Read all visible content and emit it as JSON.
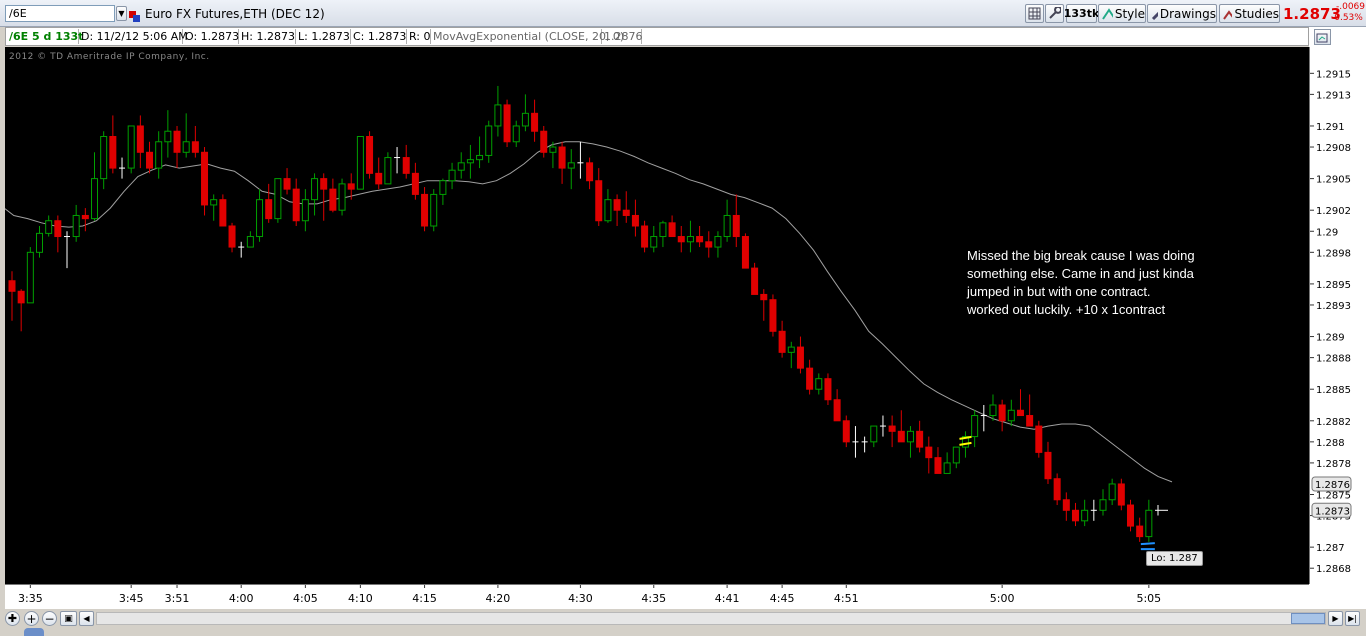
{
  "toolbar": {
    "symbol": "/6E",
    "title": "Euro FX Futures,ETH (DEC 12)",
    "tick_label": "133tk",
    "style_label": "Style",
    "drawings_label": "Drawings",
    "studies_label": "Studies",
    "last_price": "1.2873",
    "change": "-.0069",
    "change_pct": "-0.53%"
  },
  "infobar": {
    "symbol_period": "/6E 5 d 133t",
    "date": "D: 11/2/12 5:06 AM",
    "open": "O: 1.2873",
    "high": "H: 1.2873",
    "low": "L: 1.2873",
    "close": "C: 1.2873",
    "range": "R: 0",
    "study": "MovAvgExponential (CLOSE, 20, 0)",
    "study_value": "1.2876"
  },
  "watermark": "2012 © TD Ameritrade IP Company, Inc.",
  "annotation": [
    "Missed the big break cause I was doing",
    "something else.   Came in and just kinda",
    "jumped in but with one contract.",
    "worked out luckily.  +10 x 1contract"
  ],
  "low_label": "Lo: 1.287",
  "colors": {
    "up": "#00a000",
    "down": "#e00000",
    "neutral": "#ffffff",
    "ema": "#a0a0a0",
    "marker_yellow": "#ffff00",
    "marker_blue": "#1e90ff",
    "last_price": "#e00000"
  },
  "chart_data": {
    "type": "candlestick",
    "ylim": [
      1.28665,
      1.29175
    ],
    "y_ticks": [
      "1.2915",
      "1.2913",
      "1.291",
      "1.2908",
      "1.2905",
      "1.2902",
      "1.29",
      "1.2898",
      "1.2895",
      "1.2893",
      "1.289",
      "1.2888",
      "1.2885",
      "1.2882",
      "1.288",
      "1.2878",
      "1.2875",
      "1.2873",
      "1.287",
      "1.2868"
    ],
    "x_ticks": [
      "3:35",
      "3:45",
      "3:51",
      "4:00",
      "4:05",
      "4:10",
      "4:15",
      "4:20",
      "4:30",
      "4:35",
      "4:41",
      "4:45",
      "4:51",
      "5:00",
      "5:05"
    ],
    "price_labels": [
      "1.2876",
      "1.2873"
    ],
    "series": [
      {
        "name": "MovAvgExponential (CLOSE, 20, 0)",
        "values": [
          1.29025,
          1.29015,
          1.29012,
          1.29008,
          1.29005,
          1.29004,
          1.29005,
          1.2901,
          1.29022,
          1.29038,
          1.29052,
          1.29058,
          1.29063,
          1.2906,
          1.29062,
          1.29064,
          1.2906,
          1.29057,
          1.29048,
          1.29038,
          1.29035,
          1.29028,
          1.29026,
          1.29026,
          1.2903,
          1.29032,
          1.29035,
          1.29038,
          1.2904,
          1.29042,
          1.29045,
          1.29048,
          1.29048,
          1.29048,
          1.29047,
          1.29045,
          1.29048,
          1.29055,
          1.29064,
          1.29075,
          1.29082,
          1.29085,
          1.29085,
          1.29083,
          1.2908,
          1.29076,
          1.29071,
          1.29065,
          1.2906,
          1.29055,
          1.29049,
          1.29045,
          1.2904,
          1.29035,
          1.29032,
          1.29027,
          1.29022,
          1.29012,
          1.28998,
          1.28982,
          1.28962,
          1.28943,
          1.28925,
          1.28905,
          1.28893,
          1.2888,
          1.28867,
          1.28855,
          1.28847,
          1.2884,
          1.28834,
          1.28828,
          1.28822,
          1.28818,
          1.28814,
          1.28812,
          1.28815,
          1.28817,
          1.28817,
          1.28815,
          1.28805,
          1.28795,
          1.28785,
          1.28775,
          1.28767,
          1.28762
        ]
      }
    ],
    "candles": [
      [
        1.28953,
        1.28962,
        1.28915,
        1.28943
      ],
      [
        1.28943,
        1.28945,
        1.28905,
        1.28932
      ],
      [
        1.28932,
        1.28985,
        1.28932,
        1.2898
      ],
      [
        1.2898,
        1.29005,
        1.28975,
        1.28998
      ],
      [
        1.28998,
        1.29015,
        1.28995,
        1.2901
      ],
      [
        1.2901,
        1.29015,
        1.2898,
        1.28995
      ],
      [
        1.28995,
        1.29,
        1.28965,
        1.28995
      ],
      [
        1.28995,
        1.29025,
        1.2899,
        1.29015
      ],
      [
        1.29015,
        1.29022,
        1.29,
        1.29012
      ],
      [
        1.29012,
        1.29075,
        1.2901,
        1.2905
      ],
      [
        1.2905,
        1.29095,
        1.2904,
        1.2909
      ],
      [
        1.2909,
        1.2911,
        1.29055,
        1.2906
      ],
      [
        1.2906,
        1.2907,
        1.2905,
        1.2906
      ],
      [
        1.2906,
        1.291,
        1.29055,
        1.291
      ],
      [
        1.291,
        1.2911,
        1.2906,
        1.29075
      ],
      [
        1.29075,
        1.29085,
        1.29055,
        1.2906
      ],
      [
        1.2906,
        1.29095,
        1.2905,
        1.29085
      ],
      [
        1.29085,
        1.29115,
        1.2907,
        1.29095
      ],
      [
        1.29095,
        1.291,
        1.2906,
        1.29075
      ],
      [
        1.29075,
        1.29112,
        1.2907,
        1.29085
      ],
      [
        1.29085,
        1.291,
        1.2907,
        1.29075
      ],
      [
        1.29075,
        1.2908,
        1.29015,
        1.29025
      ],
      [
        1.29025,
        1.29035,
        1.2901,
        1.2903
      ],
      [
        1.2903,
        1.29035,
        1.29005,
        1.29005
      ],
      [
        1.29005,
        1.29008,
        1.2898,
        1.28985
      ],
      [
        1.28985,
        1.2899,
        1.28975,
        1.28985
      ],
      [
        1.28985,
        1.29,
        1.28985,
        1.28995
      ],
      [
        1.28995,
        1.2904,
        1.2899,
        1.2903
      ],
      [
        1.2903,
        1.29045,
        1.29008,
        1.29012
      ],
      [
        1.29012,
        1.2905,
        1.29008,
        1.2905
      ],
      [
        1.2905,
        1.2906,
        1.29035,
        1.2904
      ],
      [
        1.2904,
        1.2905,
        1.29005,
        1.2901
      ],
      [
        1.2901,
        1.2904,
        1.29,
        1.2903
      ],
      [
        1.2903,
        1.29055,
        1.29015,
        1.2905
      ],
      [
        1.2905,
        1.29055,
        1.2901,
        1.2904
      ],
      [
        1.2904,
        1.2905,
        1.29018,
        1.2902
      ],
      [
        1.2902,
        1.2905,
        1.29015,
        1.29045
      ],
      [
        1.29045,
        1.29055,
        1.2903,
        1.2904
      ],
      [
        1.2904,
        1.2909,
        1.2904,
        1.2909
      ],
      [
        1.2909,
        1.29095,
        1.2905,
        1.29055
      ],
      [
        1.29055,
        1.2907,
        1.2904,
        1.29045
      ],
      [
        1.29045,
        1.29075,
        1.29045,
        1.2907
      ],
      [
        1.2907,
        1.2908,
        1.29055,
        1.2907
      ],
      [
        1.2907,
        1.29082,
        1.2905,
        1.29055
      ],
      [
        1.29055,
        1.29065,
        1.2903,
        1.29035
      ],
      [
        1.29035,
        1.29042,
        1.29,
        1.29005
      ],
      [
        1.29005,
        1.2904,
        1.29,
        1.29035
      ],
      [
        1.29035,
        1.2905,
        1.29025,
        1.29048
      ],
      [
        1.29048,
        1.29065,
        1.2904,
        1.29058
      ],
      [
        1.29058,
        1.29075,
        1.2905,
        1.29065
      ],
      [
        1.29065,
        1.29082,
        1.2905,
        1.29068
      ],
      [
        1.29068,
        1.2909,
        1.2906,
        1.29072
      ],
      [
        1.29072,
        1.29105,
        1.29065,
        1.291
      ],
      [
        1.291,
        1.29138,
        1.2909,
        1.2912
      ],
      [
        1.2912,
        1.29125,
        1.2908,
        1.29085
      ],
      [
        1.29085,
        1.29105,
        1.2908,
        1.291
      ],
      [
        1.291,
        1.2913,
        1.29095,
        1.29112
      ],
      [
        1.29112,
        1.29125,
        1.29085,
        1.29095
      ],
      [
        1.29095,
        1.291,
        1.2907,
        1.29075
      ],
      [
        1.29075,
        1.29085,
        1.2906,
        1.2908
      ],
      [
        1.2908,
        1.29085,
        1.29045,
        1.2906
      ],
      [
        1.2906,
        1.29078,
        1.2904,
        1.29065
      ],
      [
        1.29065,
        1.29085,
        1.2905,
        1.29065
      ],
      [
        1.29065,
        1.2907,
        1.2904,
        1.29048
      ],
      [
        1.29048,
        1.2906,
        1.29005,
        1.2901
      ],
      [
        1.2901,
        1.2904,
        1.29008,
        1.2903
      ],
      [
        1.2903,
        1.29035,
        1.29005,
        1.2902
      ],
      [
        1.2902,
        1.29038,
        1.29008,
        1.29015
      ],
      [
        1.29015,
        1.2903,
        1.28995,
        1.29005
      ],
      [
        1.29005,
        1.2901,
        1.2898,
        1.28985
      ],
      [
        1.28985,
        1.29005,
        1.2898,
        1.28995
      ],
      [
        1.28995,
        1.2901,
        1.28985,
        1.29008
      ],
      [
        1.29008,
        1.29015,
        1.28995,
        1.28995
      ],
      [
        1.28995,
        1.29005,
        1.2898,
        1.2899
      ],
      [
        1.2899,
        1.2901,
        1.2898,
        1.28995
      ],
      [
        1.28995,
        1.29005,
        1.28985,
        1.2899
      ],
      [
        1.2899,
        1.29,
        1.28975,
        1.28985
      ],
      [
        1.28985,
        1.29,
        1.28975,
        1.28995
      ],
      [
        1.28995,
        1.2903,
        1.2899,
        1.29015
      ],
      [
        1.29015,
        1.29035,
        1.28985,
        1.28995
      ],
      [
        1.28995,
        1.28998,
        1.28965,
        1.28965
      ],
      [
        1.28965,
        1.2897,
        1.2894,
        1.2894
      ],
      [
        1.2894,
        1.28945,
        1.28915,
        1.28935
      ],
      [
        1.28935,
        1.2894,
        1.289,
        1.28905
      ],
      [
        1.28905,
        1.28915,
        1.2888,
        1.28885
      ],
      [
        1.28885,
        1.28895,
        1.2887,
        1.2889
      ],
      [
        1.2889,
        1.289,
        1.28865,
        1.2887
      ],
      [
        1.2887,
        1.28878,
        1.28845,
        1.2885
      ],
      [
        1.2885,
        1.28865,
        1.28845,
        1.2886
      ],
      [
        1.2886,
        1.28865,
        1.28835,
        1.2884
      ],
      [
        1.2884,
        1.2885,
        1.2882,
        1.2882
      ],
      [
        1.2882,
        1.28825,
        1.28795,
        1.288
      ],
      [
        1.288,
        1.28815,
        1.28785,
        1.288
      ],
      [
        1.288,
        1.28805,
        1.2879,
        1.288
      ],
      [
        1.288,
        1.28815,
        1.28795,
        1.28815
      ],
      [
        1.28815,
        1.28825,
        1.28805,
        1.28815
      ],
      [
        1.28815,
        1.28825,
        1.28795,
        1.2881
      ],
      [
        1.2881,
        1.2883,
        1.288,
        1.288
      ],
      [
        1.288,
        1.28815,
        1.28785,
        1.2881
      ],
      [
        1.2881,
        1.2882,
        1.2879,
        1.28795
      ],
      [
        1.28795,
        1.28805,
        1.2877,
        1.28785
      ],
      [
        1.28785,
        1.28795,
        1.2877,
        1.2877
      ],
      [
        1.2877,
        1.2879,
        1.2877,
        1.2878
      ],
      [
        1.2878,
        1.28795,
        1.28775,
        1.28795
      ],
      [
        1.28795,
        1.2881,
        1.28785,
        1.28805
      ],
      [
        1.28805,
        1.2883,
        1.28795,
        1.28825
      ],
      [
        1.28825,
        1.28835,
        1.2881,
        1.28825
      ],
      [
        1.28825,
        1.28845,
        1.2882,
        1.28835
      ],
      [
        1.28835,
        1.2884,
        1.2881,
        1.2882
      ],
      [
        1.2882,
        1.2884,
        1.28815,
        1.2883
      ],
      [
        1.2883,
        1.2885,
        1.28825,
        1.28825
      ],
      [
        1.28825,
        1.28845,
        1.28815,
        1.28815
      ],
      [
        1.28815,
        1.2882,
        1.28785,
        1.2879
      ],
      [
        1.2879,
        1.288,
        1.2876,
        1.28765
      ],
      [
        1.28765,
        1.2877,
        1.2874,
        1.28745
      ],
      [
        1.28745,
        1.28752,
        1.28725,
        1.28735
      ],
      [
        1.28735,
        1.28742,
        1.2872,
        1.28725
      ],
      [
        1.28725,
        1.28745,
        1.2872,
        1.28735
      ],
      [
        1.28735,
        1.28745,
        1.28725,
        1.28735
      ],
      [
        1.28735,
        1.28755,
        1.2873,
        1.28745
      ],
      [
        1.28745,
        1.28765,
        1.2874,
        1.2876
      ],
      [
        1.2876,
        1.28765,
        1.28735,
        1.2874
      ],
      [
        1.2874,
        1.28745,
        1.28715,
        1.2872
      ],
      [
        1.2872,
        1.28728,
        1.28705,
        1.2871
      ],
      [
        1.2871,
        1.28745,
        1.28705,
        1.28735
      ],
      [
        1.28735,
        1.2874,
        1.2873,
        1.28735
      ]
    ]
  }
}
